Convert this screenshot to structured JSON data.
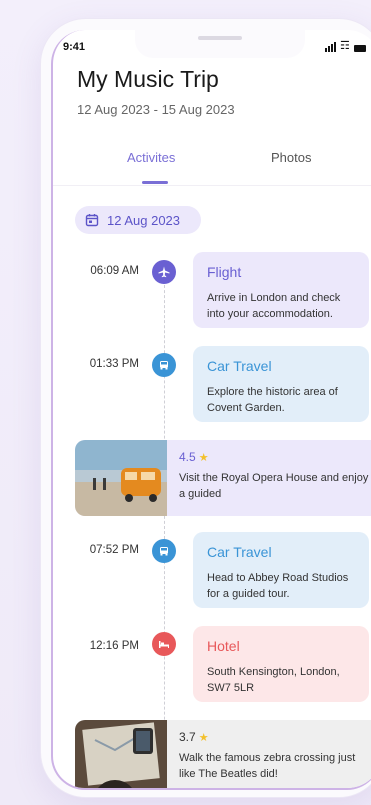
{
  "status": {
    "time": "9:41"
  },
  "trip": {
    "title": "My Music Trip",
    "date_range": "12 Aug 2023  - 15 Aug 2023"
  },
  "tabs": [
    {
      "label": "Activites",
      "active": true
    },
    {
      "label": "Photos",
      "active": false
    }
  ],
  "day": {
    "label": "12 Aug 2023"
  },
  "events": [
    {
      "time": "06:09 AM",
      "icon": "airplane-icon",
      "title": "Flight",
      "desc": "Arrive in London and check into your accommodation."
    },
    {
      "time": "01:33 PM",
      "icon": "car-icon",
      "title": "Car Travel",
      "desc": "Explore the historic area of Covent Garden."
    },
    {
      "time": "07:52 PM",
      "icon": "car-icon",
      "title": "Car Travel",
      "desc": "Head to Abbey Road Studios for a guided tour."
    },
    {
      "time": "12:16 PM",
      "icon": "bed-icon",
      "title": "Hotel",
      "desc": "South Kensington, London, SW7 5LR"
    }
  ],
  "photo_cards": [
    {
      "rating": "4.5",
      "desc": "Visit the Royal Opera House and enjoy a guided"
    },
    {
      "rating": "3.7",
      "desc": "Walk the famous zebra crossing just like The Beatles did!"
    }
  ],
  "colors": {
    "accent": "#7a6fd6",
    "blue": "#3a94d6",
    "red": "#e8585a",
    "star": "#f3c12d"
  }
}
